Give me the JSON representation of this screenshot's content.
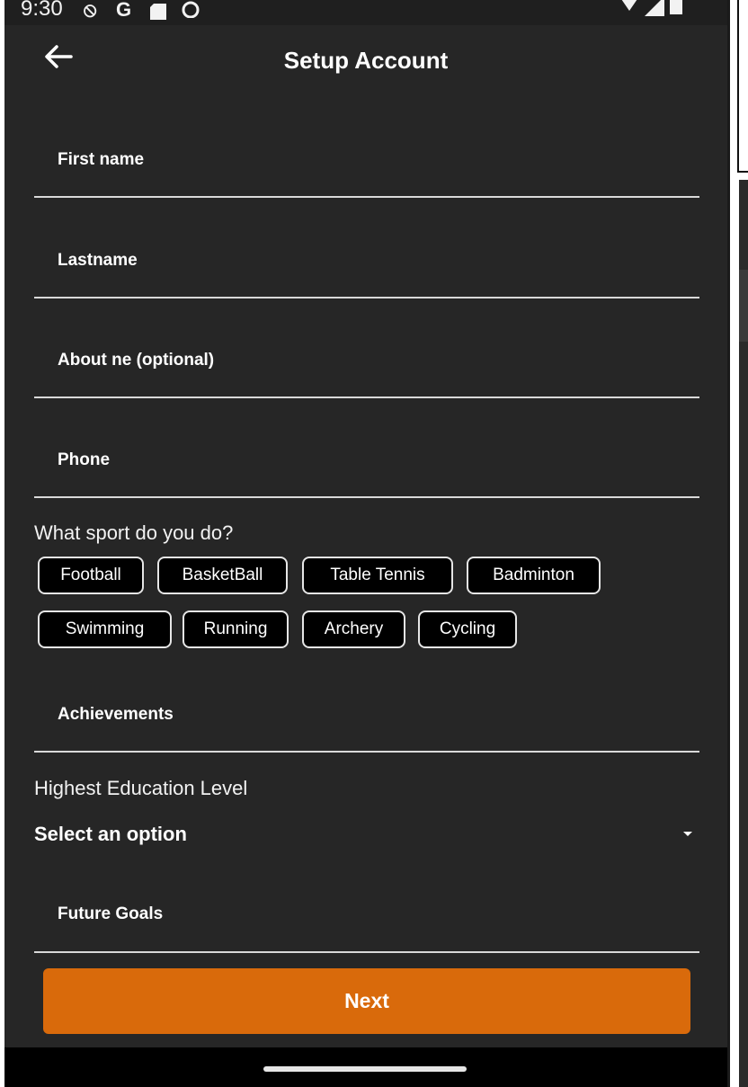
{
  "status_bar": {
    "time": "9:30",
    "icons": [
      "vpn-icon",
      "google-icon",
      "sd-card-icon",
      "assistant-icon"
    ],
    "right_icons": [
      "wifi-icon",
      "signal-icon",
      "battery-icon"
    ]
  },
  "app_bar": {
    "title": "Setup Account",
    "back_icon": "arrow-left-icon"
  },
  "form": {
    "first_name_label": "First name",
    "last_name_label": "Lastname",
    "about_label": "About ne (optional)",
    "phone_label": "Phone",
    "sport_question": "What sport do you do?",
    "sports": [
      "Football",
      "BasketBall",
      "Table Tennis",
      "Badminton",
      "Swimming",
      "Running",
      "Archery",
      "Cycling"
    ],
    "achievements_label": "Achievements",
    "education_label": "Highest Education Level",
    "education_select_value": "Select an option",
    "future_goals_label": "Future Goals"
  },
  "actions": {
    "next_label": "Next"
  },
  "colors": {
    "background": "#262626",
    "accent": "#d96a0b"
  }
}
